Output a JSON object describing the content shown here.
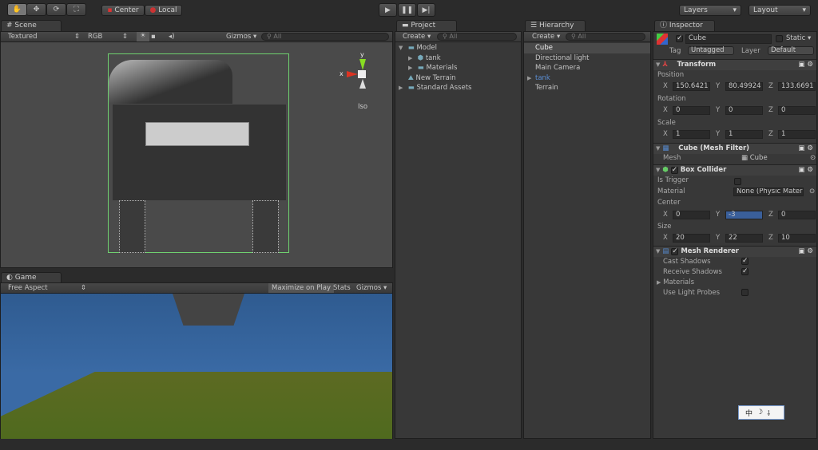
{
  "toolbar": {
    "tools": [
      "hand-icon",
      "move-icon",
      "rotate-icon",
      "scale-icon"
    ],
    "pivot": "Center",
    "space": "Local",
    "layers": "Layers",
    "layout": "Layout"
  },
  "scene": {
    "tab": "Scene",
    "render_mode": "Textured",
    "channel": "RGB",
    "gizmos": "Gizmos",
    "search": "All",
    "gizmo_x": "x",
    "gizmo_y": "y",
    "projection": "Iso"
  },
  "game": {
    "tab": "Game",
    "aspect": "Free Aspect",
    "maximize": "Maximize on Play",
    "stats": "Stats",
    "gizmos": "Gizmos"
  },
  "project": {
    "tab": "Project",
    "create": "Create",
    "search": "All",
    "items": [
      {
        "label": "Model",
        "indent": 0,
        "arrow": "▼"
      },
      {
        "label": "tank",
        "indent": 1,
        "arrow": "▶"
      },
      {
        "label": "Materials",
        "indent": 1,
        "arrow": "▶"
      },
      {
        "label": "New Terrain",
        "indent": 0,
        "arrow": ""
      },
      {
        "label": "Standard Assets",
        "indent": 0,
        "arrow": "▶"
      }
    ]
  },
  "hierarchy": {
    "tab": "Hierarchy",
    "create": "Create",
    "search": "All",
    "items": [
      {
        "label": "Cube",
        "selected": true
      },
      {
        "label": "Directional light"
      },
      {
        "label": "Main Camera"
      },
      {
        "label": "tank",
        "prefab": true
      },
      {
        "label": "Terrain"
      }
    ]
  },
  "inspector": {
    "tab": "Inspector",
    "name": "Cube",
    "static": "Static",
    "tag_label": "Tag",
    "tag": "Untagged",
    "layer_label": "Layer",
    "layer": "Default",
    "transform": {
      "title": "Transform",
      "position": "Position",
      "rotation": "Rotation",
      "scale": "Scale",
      "pos": [
        "150.6421",
        "80.49924",
        "133.6691"
      ],
      "rot": [
        "0",
        "0",
        "0"
      ],
      "scl": [
        "1",
        "1",
        "1"
      ]
    },
    "mesh_filter": {
      "title": "Cube (Mesh Filter)",
      "mesh_label": "Mesh",
      "mesh": "Cube"
    },
    "box_collider": {
      "title": "Box Collider",
      "is_trigger": "Is Trigger",
      "material_label": "Material",
      "material": "None (Physic Mater",
      "center": "Center",
      "center_vals": [
        "0",
        "-3",
        "0"
      ],
      "size": "Size",
      "size_vals": [
        "20",
        "22",
        "10"
      ]
    },
    "mesh_renderer": {
      "title": "Mesh Renderer",
      "cast": "Cast Shadows",
      "receive": "Receive Shadows",
      "materials": "Materials",
      "probes": "Use Light Probes"
    },
    "axes": [
      "X",
      "Y",
      "Z"
    ]
  },
  "ime": {
    "lang": "中",
    "moon": "☽",
    "punct": "⸸"
  }
}
